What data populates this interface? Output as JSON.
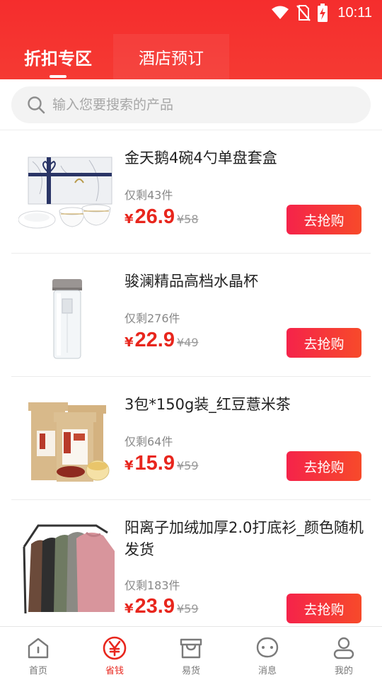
{
  "status_bar": {
    "time": "10:11"
  },
  "tabs": [
    {
      "label": "折扣专区",
      "active": true
    },
    {
      "label": "酒店预订",
      "active": false
    }
  ],
  "search": {
    "placeholder": "输入您要搜索的产品",
    "value": ""
  },
  "currency_symbol": "¥",
  "buy_label": "去抢购",
  "products": [
    {
      "title": "金天鹅4碗4勺单盘套盒",
      "stock": "仅剩43件",
      "price": "26.9",
      "original": "¥58",
      "image": "white-porcelain-bowl-set"
    },
    {
      "title": "骏澜精品高档水晶杯",
      "stock": "仅剩276件",
      "price": "22.9",
      "original": "¥49",
      "image": "crystal-water-bottle"
    },
    {
      "title": "3包*150g装_红豆薏米茶",
      "stock": "仅剩64件",
      "price": "15.9",
      "original": "¥59",
      "image": "red-bean-tea-bags"
    },
    {
      "title": "阳离子加绒加厚2.0打底衫_颜色随机发货",
      "stock": "仅剩183件",
      "price": "23.9",
      "original": "¥59",
      "image": "knit-sweaters-on-rack"
    }
  ],
  "bottom_nav": [
    {
      "label": "首页",
      "icon": "home-icon",
      "active": false
    },
    {
      "label": "省钱",
      "icon": "yen-icon",
      "active": true
    },
    {
      "label": "易货",
      "icon": "store-icon",
      "active": false
    },
    {
      "label": "消息",
      "icon": "message-icon",
      "active": false
    },
    {
      "label": "我的",
      "icon": "profile-icon",
      "active": false
    }
  ],
  "colors": {
    "header_red": "#f5302f",
    "price_red": "#e8261d",
    "button_gradient_start": "#f5234a",
    "button_gradient_end": "#f74a2a"
  }
}
